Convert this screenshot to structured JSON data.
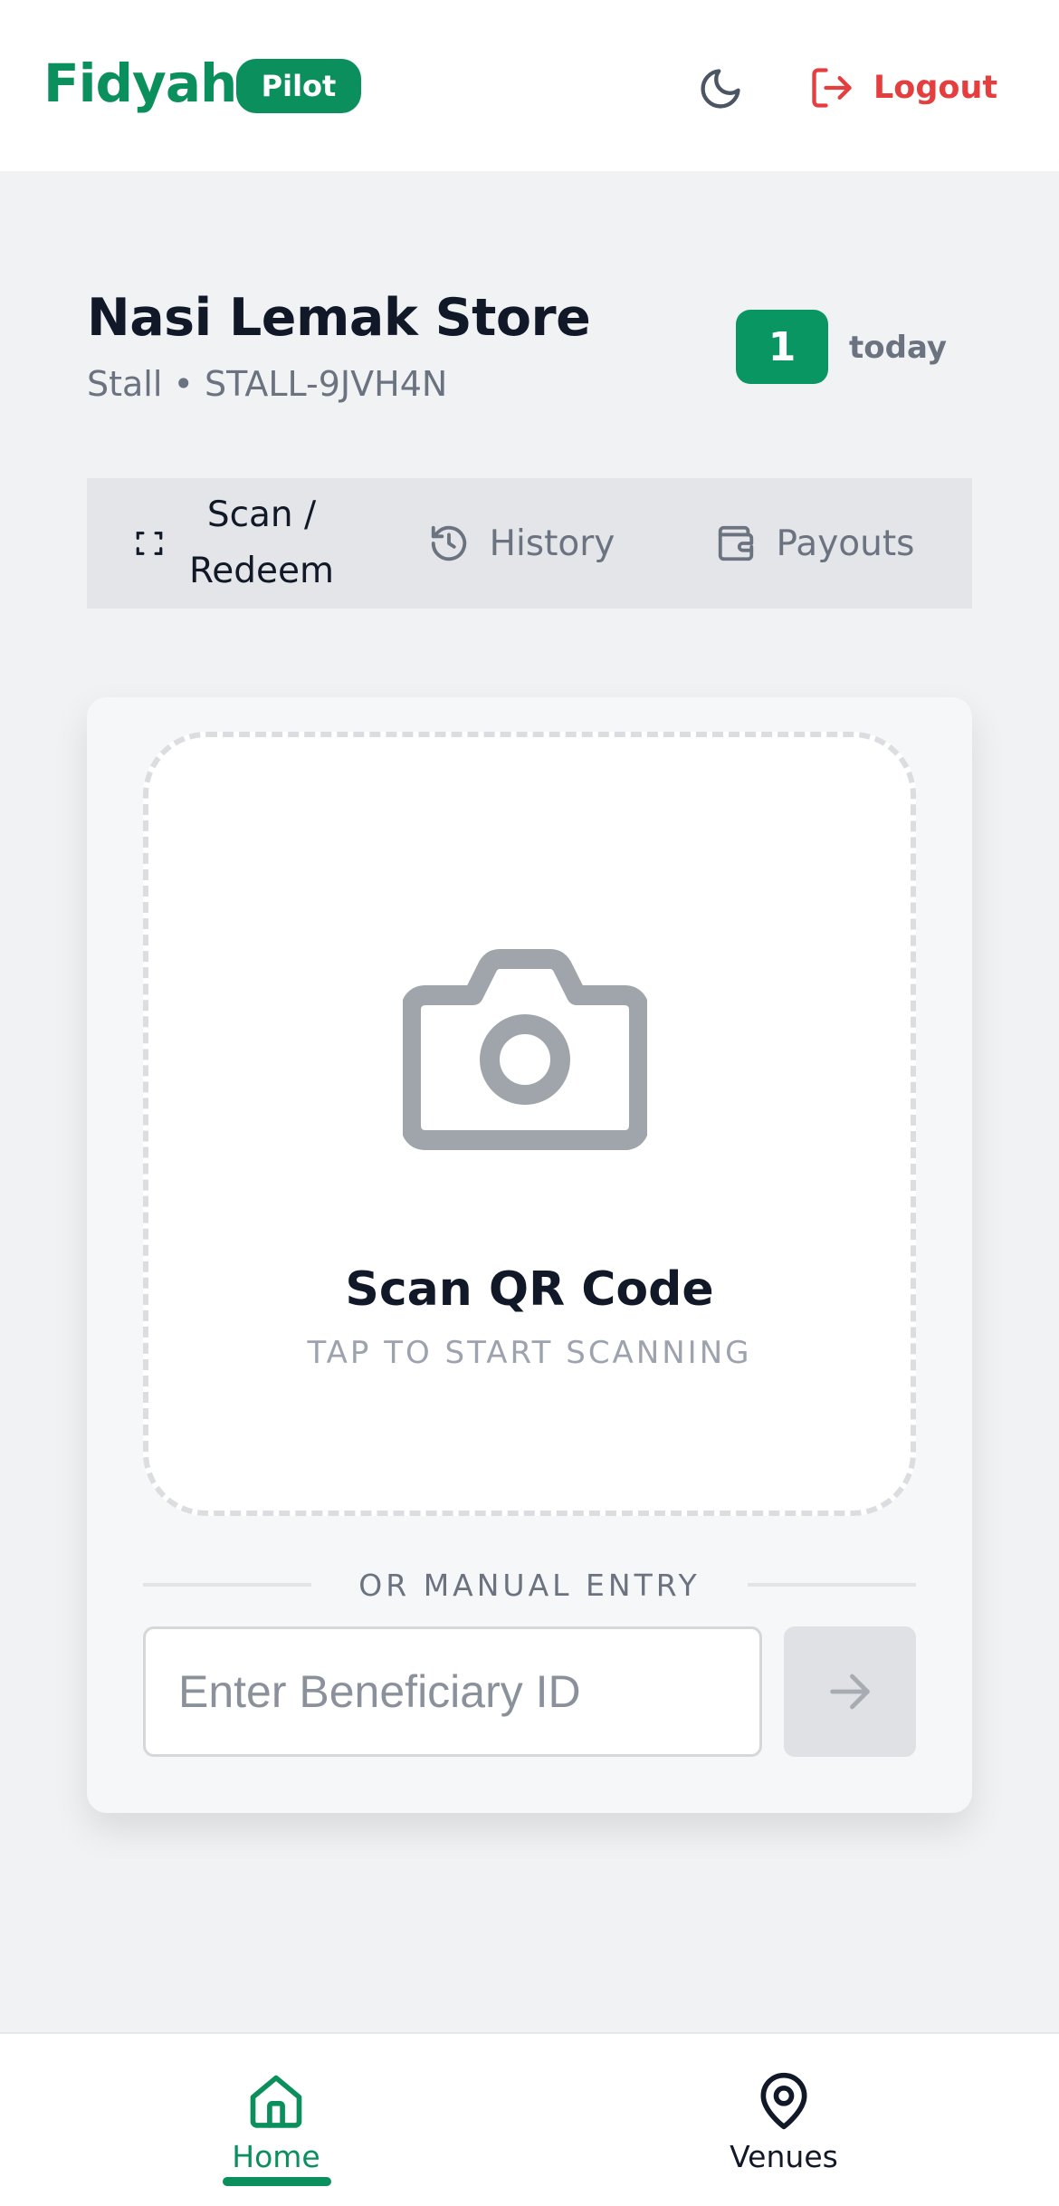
{
  "header": {
    "brand": "Fidyah",
    "badge": "Pilot",
    "logout_label": "Logout"
  },
  "store": {
    "name": "Nasi Lemak Store",
    "subtitle": "Stall • STALL-9JVH4N",
    "count": "1",
    "count_label": "today"
  },
  "tabs": [
    {
      "label": "Scan / Redeem",
      "icon": "scan-frame-icon",
      "active": true
    },
    {
      "label": "History",
      "icon": "history-icon",
      "active": false
    },
    {
      "label": "Payouts",
      "icon": "wallet-icon",
      "active": false
    }
  ],
  "scanner": {
    "icon": "camera-icon",
    "title": "Scan QR Code",
    "subtitle": "TAP TO START SCANNING"
  },
  "manual": {
    "divider": "OR MANUAL ENTRY",
    "placeholder": "Enter Beneficiary ID",
    "value": ""
  },
  "bottom_nav": [
    {
      "label": "Home",
      "icon": "home-icon",
      "active": true
    },
    {
      "label": "Venues",
      "icon": "map-pin-icon",
      "active": false
    }
  ],
  "colors": {
    "brand": "#0a8f5d",
    "logout": "#e53e3e",
    "muted": "#6b7280"
  }
}
